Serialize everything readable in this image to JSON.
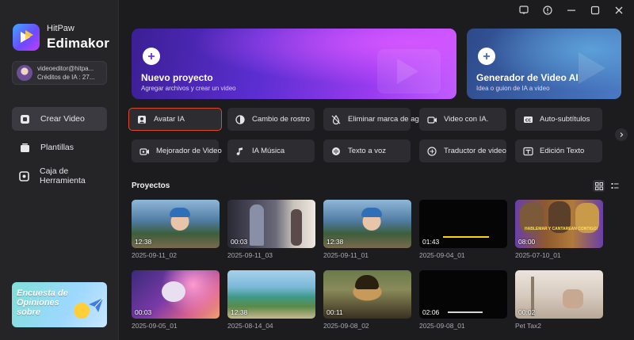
{
  "app": {
    "brand_small": "HitPaw",
    "brand_big": "Edimakor"
  },
  "account": {
    "email": "videoeditor@hitpa...",
    "credits": "Créditos de IA : 27..."
  },
  "nav": [
    {
      "label": "Crear Video",
      "icon": "video-create-icon",
      "active": true
    },
    {
      "label": "Plantillas",
      "icon": "templates-icon",
      "active": false
    },
    {
      "label": "Caja de Herramienta",
      "icon": "toolbox-icon",
      "active": false
    }
  ],
  "banner": {
    "text": "Encuesta de Opiniones sobre"
  },
  "hero": {
    "new_project": {
      "title": "Nuevo proyecto",
      "subtitle": "Agregar archivos y crear un video"
    },
    "ai_generator": {
      "title": "Generador de Video AI",
      "subtitle": "Idea o guion de IA a video"
    }
  },
  "tools": [
    {
      "label": "Avatar IA",
      "icon": "avatar-icon"
    },
    {
      "label": "Cambio de rostro",
      "icon": "face-swap-icon"
    },
    {
      "label": "Eliminar marca de agua",
      "icon": "watermark-remove-icon"
    },
    {
      "label": "Video con IA.",
      "icon": "ai-video-icon"
    },
    {
      "label": "Auto-subtítulos",
      "icon": "subtitles-icon"
    },
    {
      "label": "Mejorador de Video",
      "icon": "video-enhancer-icon"
    },
    {
      "label": "IA Música",
      "icon": "music-icon"
    },
    {
      "label": "Texto a voz",
      "icon": "text-to-speech-icon"
    },
    {
      "label": "Traductor de video",
      "icon": "translate-icon"
    },
    {
      "label": "Edición Texto",
      "icon": "text-edit-icon"
    }
  ],
  "projects_section": {
    "title": "Proyectos"
  },
  "projects": [
    {
      "name": "2025-09-11_02",
      "duration": "12:38"
    },
    {
      "name": "2025-09-11_03",
      "duration": "00:03"
    },
    {
      "name": "2025-09-11_01",
      "duration": "12:38"
    },
    {
      "name": "2025-09-04_01",
      "duration": "01:43"
    },
    {
      "name": "2025-07-10_01",
      "duration": "08:00",
      "overlay_text": "HABLEMAR Y CANTAREAN CONTIGO!"
    },
    {
      "name": "2025-09-05_01",
      "duration": "00:03"
    },
    {
      "name": "2025-08-14_04",
      "duration": "12:38"
    },
    {
      "name": "2025-09-08_02",
      "duration": "00:11"
    },
    {
      "name": "2025-09-08_01",
      "duration": "02:06"
    },
    {
      "name": "Pet Tax2",
      "duration": "00:02"
    }
  ],
  "colors": {
    "background": "#1c1c1f",
    "sidebar": "#252528",
    "button": "#2d2d31",
    "highlight_border": "#e0462e",
    "accent_purple": "#7b35e8"
  }
}
